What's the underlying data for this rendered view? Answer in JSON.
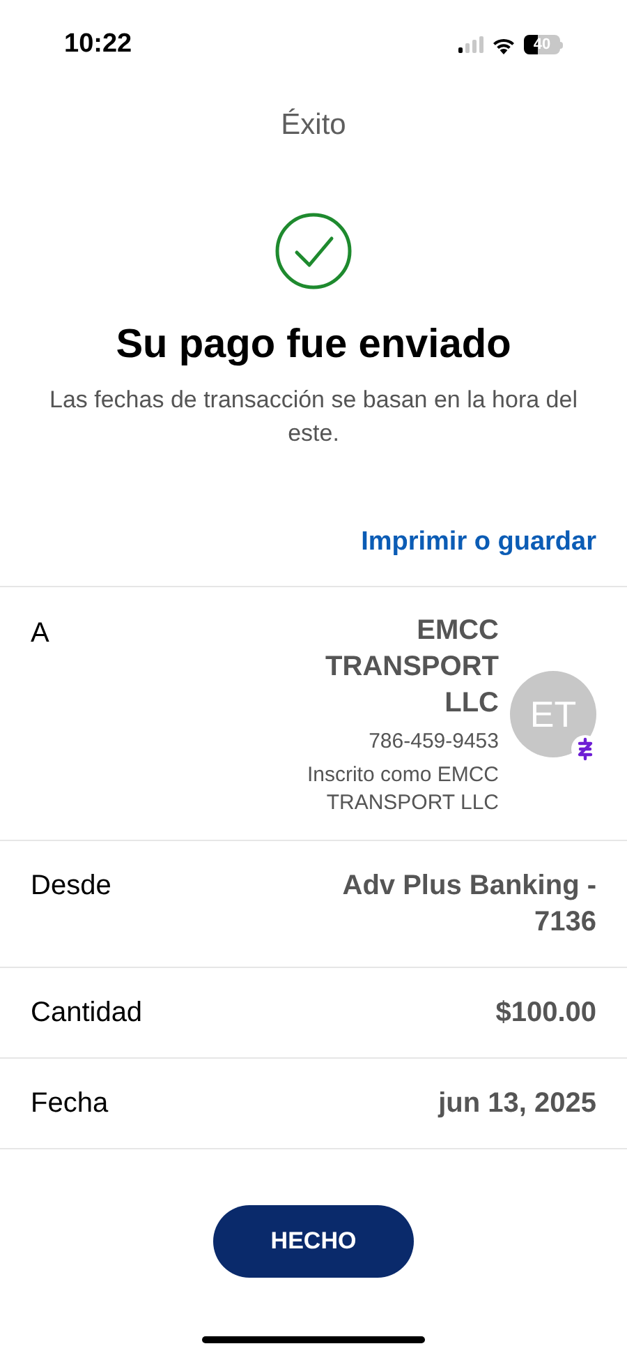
{
  "status_bar": {
    "time": "10:22",
    "battery": "40"
  },
  "header": {
    "title": "Éxito"
  },
  "confirmation": {
    "heading": "Su pago fue enviado",
    "subtitle": "Las fechas de transacción se basan en la hora del este."
  },
  "print_link": "Imprimir o guardar",
  "recipient": {
    "label": "A",
    "name": "EMCC TRANSPORT LLC",
    "phone": "786-459-9453",
    "registered_as": "Inscrito como EMCC TRANSPORT LLC",
    "initials": "ET"
  },
  "details": [
    {
      "label": "Desde",
      "value": "Adv Plus Banking - 7136"
    },
    {
      "label": "Cantidad",
      "value": "$100.00"
    },
    {
      "label": "Fecha",
      "value": "jun 13, 2025"
    }
  ],
  "done_button": "HECHO"
}
